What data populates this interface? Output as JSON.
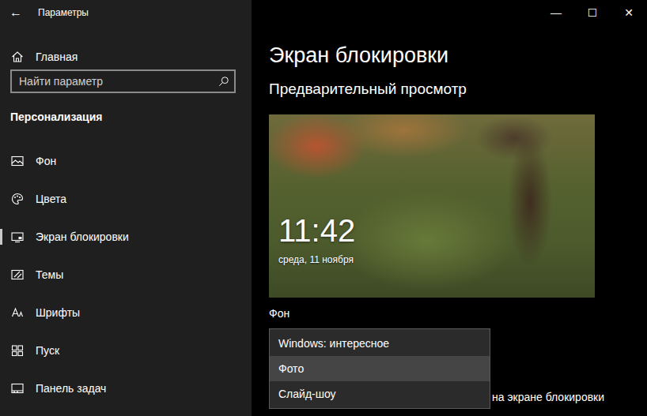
{
  "window": {
    "title": "Параметры",
    "back": "←",
    "controls": [
      "—",
      "☐",
      "✕"
    ]
  },
  "sidebar": {
    "home": "Главная",
    "search": {
      "placeholder": "Найти параметр"
    },
    "section": "Персонализация",
    "items": [
      {
        "label": "Фон",
        "selected": false
      },
      {
        "label": "Цвета",
        "selected": false
      },
      {
        "label": "Экран блокировки",
        "selected": true
      },
      {
        "label": "Темы",
        "selected": false
      },
      {
        "label": "Шрифты",
        "selected": false
      },
      {
        "label": "Пуск",
        "selected": false
      },
      {
        "label": "Панель задач",
        "selected": false
      }
    ]
  },
  "page": {
    "title": "Экран блокировки",
    "preview_heading": "Предварительный просмотр",
    "preview": {
      "time": "11:42",
      "date": "среда, 11 ноября"
    },
    "background_label": "Фон",
    "dropdown": {
      "options": [
        {
          "label": "Windows: интересное",
          "selected": false
        },
        {
          "label": "Фото",
          "selected": true
        },
        {
          "label": "Слайд-шоу",
          "selected": false
        }
      ]
    },
    "obscured_text": "на экране блокировки"
  }
}
